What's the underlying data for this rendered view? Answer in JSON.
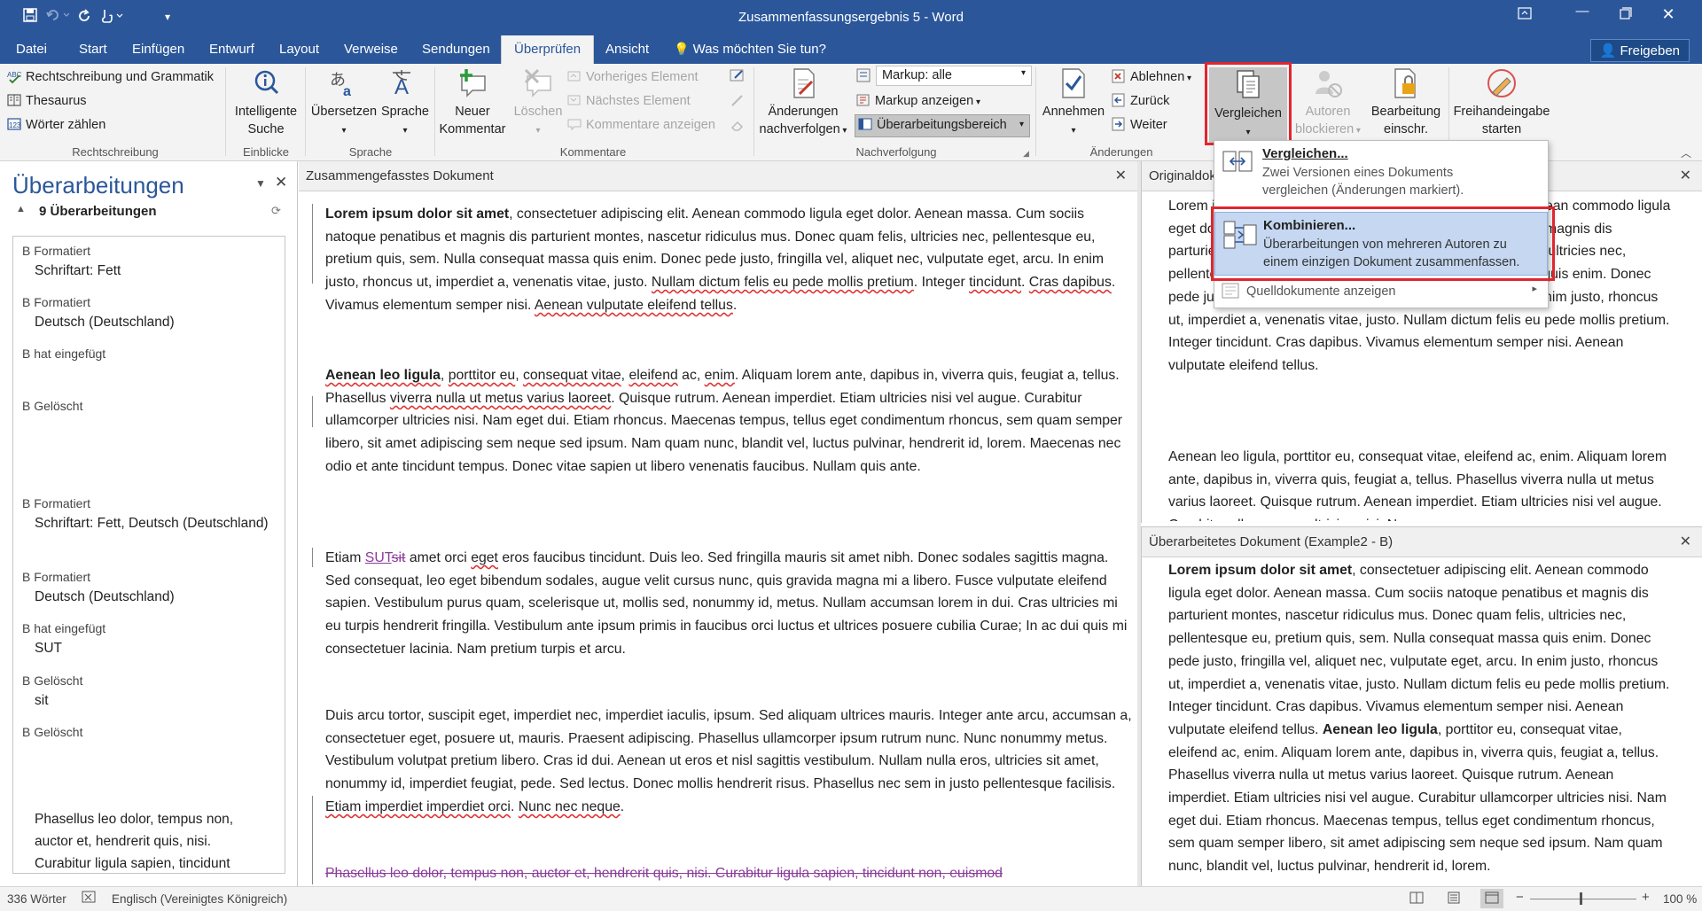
{
  "titlebar": {
    "title": "Zusammenfassungsergebnis 5 - Word",
    "save_icon": "save-icon",
    "undo_icon": "undo-icon",
    "redo_icon": "redo-icon",
    "touch_icon": "touch-mode-icon"
  },
  "tabs": [
    "Datei",
    "Start",
    "Einfügen",
    "Entwurf",
    "Layout",
    "Verweise",
    "Sendungen",
    "Überprüfen",
    "Ansicht"
  ],
  "tellme": "Was möchten Sie tun?",
  "share": "Freigeben",
  "ribbon": {
    "spelling": "Rechtschreibung und Grammatik",
    "thesaurus": "Thesaurus",
    "wordcount": "Wörter zählen",
    "group_spelling": "Rechtschreibung",
    "smart_lookup_1": "Intelligente",
    "smart_lookup_2": "Suche",
    "group_insights": "Einblicke",
    "translate": "Übersetzen",
    "language": "Sprache",
    "group_language": "Sprache",
    "new_comment_1": "Neuer",
    "new_comment_2": "Kommentar",
    "delete": "Löschen",
    "prev": "Vorheriges Element",
    "next": "Nächstes Element",
    "show_comments": "Kommentare anzeigen",
    "group_comments": "Kommentare",
    "track_1": "Änderungen",
    "track_2": "nachverfolgen",
    "markup_select": "Markup: alle",
    "show_markup": "Markup anzeigen",
    "review_pane": "Überarbeitungsbereich",
    "group_tracking": "Nachverfolgung",
    "accept": "Annehmen",
    "reject": "Ablehnen",
    "back": "Zurück",
    "forward": "Weiter",
    "group_changes": "Änderungen",
    "compare": "Vergleichen",
    "block_1": "Autoren",
    "block_2": "blockieren",
    "restrict_1": "Bearbeitung",
    "restrict_2": "einschr.",
    "ink_1": "Freihandeingabe",
    "ink_2": "starten"
  },
  "menu": {
    "compare_title": "Vergleichen...",
    "compare_desc_1": "Zwei Versionen eines Dokuments",
    "compare_desc_2": "vergleichen (Änderungen markiert).",
    "combine_title": "Kombinieren...",
    "combine_desc_1": "Überarbeitungen von mehreren Autoren zu",
    "combine_desc_2": "einem einzigen Dokument zusammenfassen.",
    "source_docs": "Quelldokumente anzeigen"
  },
  "revisions_pane": {
    "title": "Überarbeitungen",
    "count": "9 Überarbeitungen",
    "items": [
      {
        "who": "B Formatiert",
        "what": "Schriftart: Fett"
      },
      {
        "who": "B Formatiert",
        "what": "Deutsch (Deutschland)"
      },
      {
        "who": "B hat eingefügt",
        "what": ""
      },
      {
        "who": "B Gelöscht",
        "what": ""
      },
      {
        "who": "B Formatiert",
        "what": "Schriftart: Fett, Deutsch (Deutschland)"
      },
      {
        "who": "B Formatiert",
        "what": "Deutsch (Deutschland)"
      },
      {
        "who": "B hat eingefügt",
        "what": "SUT"
      },
      {
        "who": "B Gelöscht",
        "what": "sit"
      },
      {
        "who": "B Gelöscht",
        "what": ""
      }
    ],
    "tail_text": "Phasellus leo dolor, tempus non, auctor et, hendrerit quis, nisi. Curabitur ligula sapien, tincidunt"
  },
  "main_doc": {
    "header": "Zusammengefasstes Dokument",
    "p1_bold": "Lorem ipsum dolor sit amet",
    "p1_a": ", consectetuer adipiscing elit. Aenean commodo ligula eget dolor. Aenean massa. Cum sociis natoque penatibus et magnis dis parturient montes, nascetur ridiculus mus. Donec quam felis, ultricies nec, pellentesque eu, pretium quis, sem. Nulla consequat massa quis enim. Donec pede justo, fringilla vel, aliquet nec, vulputate eget, arcu. In enim justo, rhoncus ut, imperdiet a, venenatis vitae, justo. ",
    "p1_sq1": "Nullam dictum felis eu pede mollis pretium",
    "p1_b": ". Integer ",
    "p1_sq2": "tincidunt",
    "p1_c": ". ",
    "p1_sq3": "Cras dapibus",
    "p1_d": ". Vivamus elementum semper nisi. ",
    "p1_sq4": "Aenean vulputate eleifend tellus",
    "p1_e": ".",
    "p2_bold": "Aenean leo ligula",
    "p2_a": ", ",
    "p2_sq1": "porttitor eu",
    "p2_b": ", ",
    "p2_sq2": "consequat vitae",
    "p2_c": ", ",
    "p2_sq3": "eleifend",
    "p2_d": " ac, ",
    "p2_sq4": "enim",
    "p2_e": ". Aliquam lorem ante, dapibus in, viverra quis, feugiat a, tellus. Phasellus ",
    "p2_sq5": "viverra nulla ut metus varius laoreet",
    "p2_f": ". Quisque rutrum. Aenean imperdiet. Etiam ultricies nisi vel augue. Curabitur ullamcorper ultricies nisi. Nam eget dui. Etiam rhoncus. Maecenas tempus, tellus eget condimentum rhoncus, sem quam semper libero, sit amet adipiscing sem neque sed ipsum. Nam quam nunc, blandit vel, luctus pulvinar, hendrerit id, lorem. Maecenas nec odio et ante tincidunt tempus. Donec vitae sapien ut libero venenatis faucibus. Nullam quis ante.",
    "p3_a": "Etiam ",
    "p3_ins": "SUT",
    "p3_del": "sit",
    "p3_b": " amet orci ",
    "p3_sq1": "eget",
    "p3_c": " eros faucibus tincidunt. Duis leo. Sed fringilla mauris sit amet nibh. Donec sodales sagittis magna. Sed consequat, leo eget bibendum sodales, augue velit cursus nunc, quis gravida magna mi a libero. Fusce vulputate eleifend sapien. Vestibulum purus quam, scelerisque ut, mollis sed, nonummy id, metus. Nullam accumsan lorem in dui. Cras ultricies mi eu turpis hendrerit fringilla. Vestibulum ante ipsum primis in faucibus orci luctus et ultrices posuere cubilia Curae; In ac dui quis mi consectetuer lacinia. Nam pretium turpis et arcu.",
    "p4_a": "Duis arcu tortor, suscipit eget, imperdiet nec, imperdiet iaculis, ipsum. Sed aliquam ultrices mauris. Integer ante arcu, accumsan a, consectetuer eget, posuere ut, mauris. Praesent adipiscing. Phasellus ullamcorper ipsum rutrum nunc. Nunc nonummy metus. Vestibulum volutpat pretium libero. Cras id dui. Aenean ut eros et nisl sagittis vestibulum. Nullam nulla eros, ultricies sit amet, nonummy id, imperdiet feugiat, pede. Sed lectus. Donec mollis hendrerit risus. Phasellus nec sem in justo pellentesque facilisis. ",
    "p4_sq1": "Etiam imperdiet imperdiet orci",
    "p4_b": ". ",
    "p4_sq2": "Nunc nec neque",
    "p4_c": ".",
    "p5_del": "Phasellus leo dolor, tempus non, auctor et, hendrerit quis, nisi. Curabitur ligula sapien, tincidunt non, euismod"
  },
  "original_doc": {
    "header": "Originaldokument",
    "p1": "Lorem ipsum dolor sit amet, consectetuer adipiscing elit. Aenean commodo ligula eget dolor. Aenean massa. Cum sociis natoque penatibus et magnis dis parturient montes, nascetur ridiculus mus. Donec quam felis, ultricies nec, pellentesque eu, pretium quis, sem. Nulla consequat massa quis enim. Donec pede justo, fringilla vel, aliquet nec, vulputate eget, arcu. In enim justo, rhoncus ut, imperdiet a, venenatis vitae, justo. Nullam dictum felis eu pede mollis pretium. Integer tincidunt. Cras dapibus. Vivamus elementum semper nisi. Aenean vulputate eleifend tellus.",
    "p2": "Aenean leo ligula, porttitor eu, consequat vitae, eleifend ac, enim. Aliquam lorem ante, dapibus in, viverra quis, feugiat a, tellus. Phasellus viverra nulla ut metus varius laoreet. Quisque rutrum. Aenean imperdiet. Etiam ultricies nisi vel augue. Curabitur ullamcorper ultricies nisi. Nam"
  },
  "revised_doc": {
    "header": "Überarbeitetes Dokument (Example2 - B)",
    "p1_bold": "Lorem ipsum dolor sit amet",
    "p1_a": ", consectetuer adipiscing elit. Aenean commodo ligula eget dolor. Aenean massa. Cum sociis natoque penatibus et magnis dis parturient montes, nascetur ridiculus mus. Donec quam felis, ultricies nec, pellentesque eu, pretium quis, sem. Nulla consequat massa quis enim. Donec pede justo, fringilla vel, aliquet nec, vulputate eget, arcu. In enim justo, rhoncus ut, imperdiet a, venenatis vitae, justo. Nullam dictum felis eu pede mollis pretium. Integer tincidunt. Cras dapibus. Vivamus elementum semper nisi. Aenean vulputate eleifend tellus. ",
    "p1_bold2": "Aenean leo ligula",
    "p1_b": ", porttitor eu, consequat vitae, eleifend ac, enim. Aliquam lorem ante, dapibus in, viverra quis, feugiat a, tellus. Phasellus viverra nulla ut metus varius laoreet. Quisque rutrum. Aenean imperdiet. Etiam ultricies nisi vel augue. Curabitur ullamcorper ultricies nisi. Nam eget dui. Etiam rhoncus. Maecenas tempus, tellus eget condimentum rhoncus, sem quam semper libero, sit amet adipiscing sem neque sed ipsum. Nam quam nunc, blandit vel, luctus pulvinar, hendrerit id, lorem."
  },
  "status": {
    "words": "336 Wörter",
    "language": "Englisch (Vereinigtes Königreich)",
    "zoom": "100 %"
  }
}
